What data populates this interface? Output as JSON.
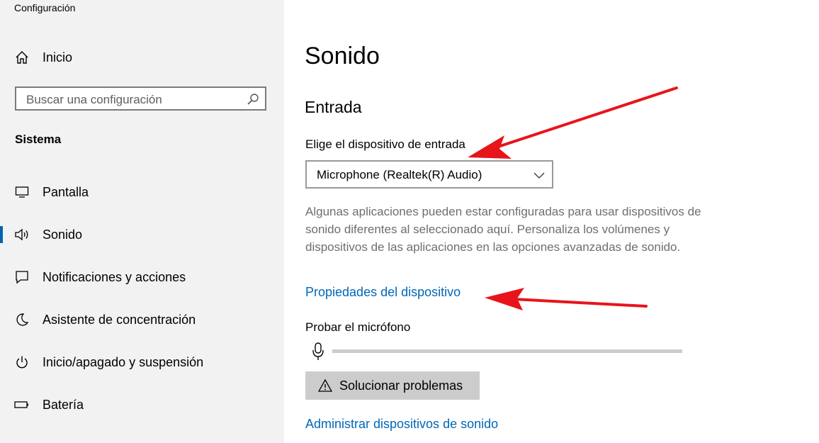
{
  "window": {
    "title": "Configuración"
  },
  "sidebar": {
    "home_label": "Inicio",
    "search_placeholder": "Buscar una configuración",
    "section_label": "Sistema",
    "items": [
      {
        "label": "Pantalla",
        "icon": "monitor-icon",
        "active": false
      },
      {
        "label": "Sonido",
        "icon": "speaker-icon",
        "active": true
      },
      {
        "label": "Notificaciones y acciones",
        "icon": "notification-icon",
        "active": false
      },
      {
        "label": "Asistente de concentración",
        "icon": "moon-icon",
        "active": false
      },
      {
        "label": "Inicio/apagado y suspensión",
        "icon": "power-icon",
        "active": false
      },
      {
        "label": "Batería",
        "icon": "battery-icon",
        "active": false
      }
    ]
  },
  "main": {
    "page_title": "Sonido",
    "section_title": "Entrada",
    "input_device_label": "Elige el dispositivo de entrada",
    "input_device_value": "Microphone (Realtek(R) Audio)",
    "description": "Algunas aplicaciones pueden estar configuradas para usar dispositivos de sonido diferentes al seleccionado aquí. Personaliza los volúmenes y dispositivos de las aplicaciones en las opciones avanzadas de sonido.",
    "device_properties_link": "Propiedades del dispositivo",
    "test_mic_label": "Probar el micrófono",
    "mic_level": 0,
    "troubleshoot_button": "Solucionar problemas",
    "manage_devices_link": "Administrar dispositivos de sonido"
  },
  "colors": {
    "accent": "#0063b1",
    "link": "#0067b8",
    "annotation_arrow": "#e8141b"
  }
}
